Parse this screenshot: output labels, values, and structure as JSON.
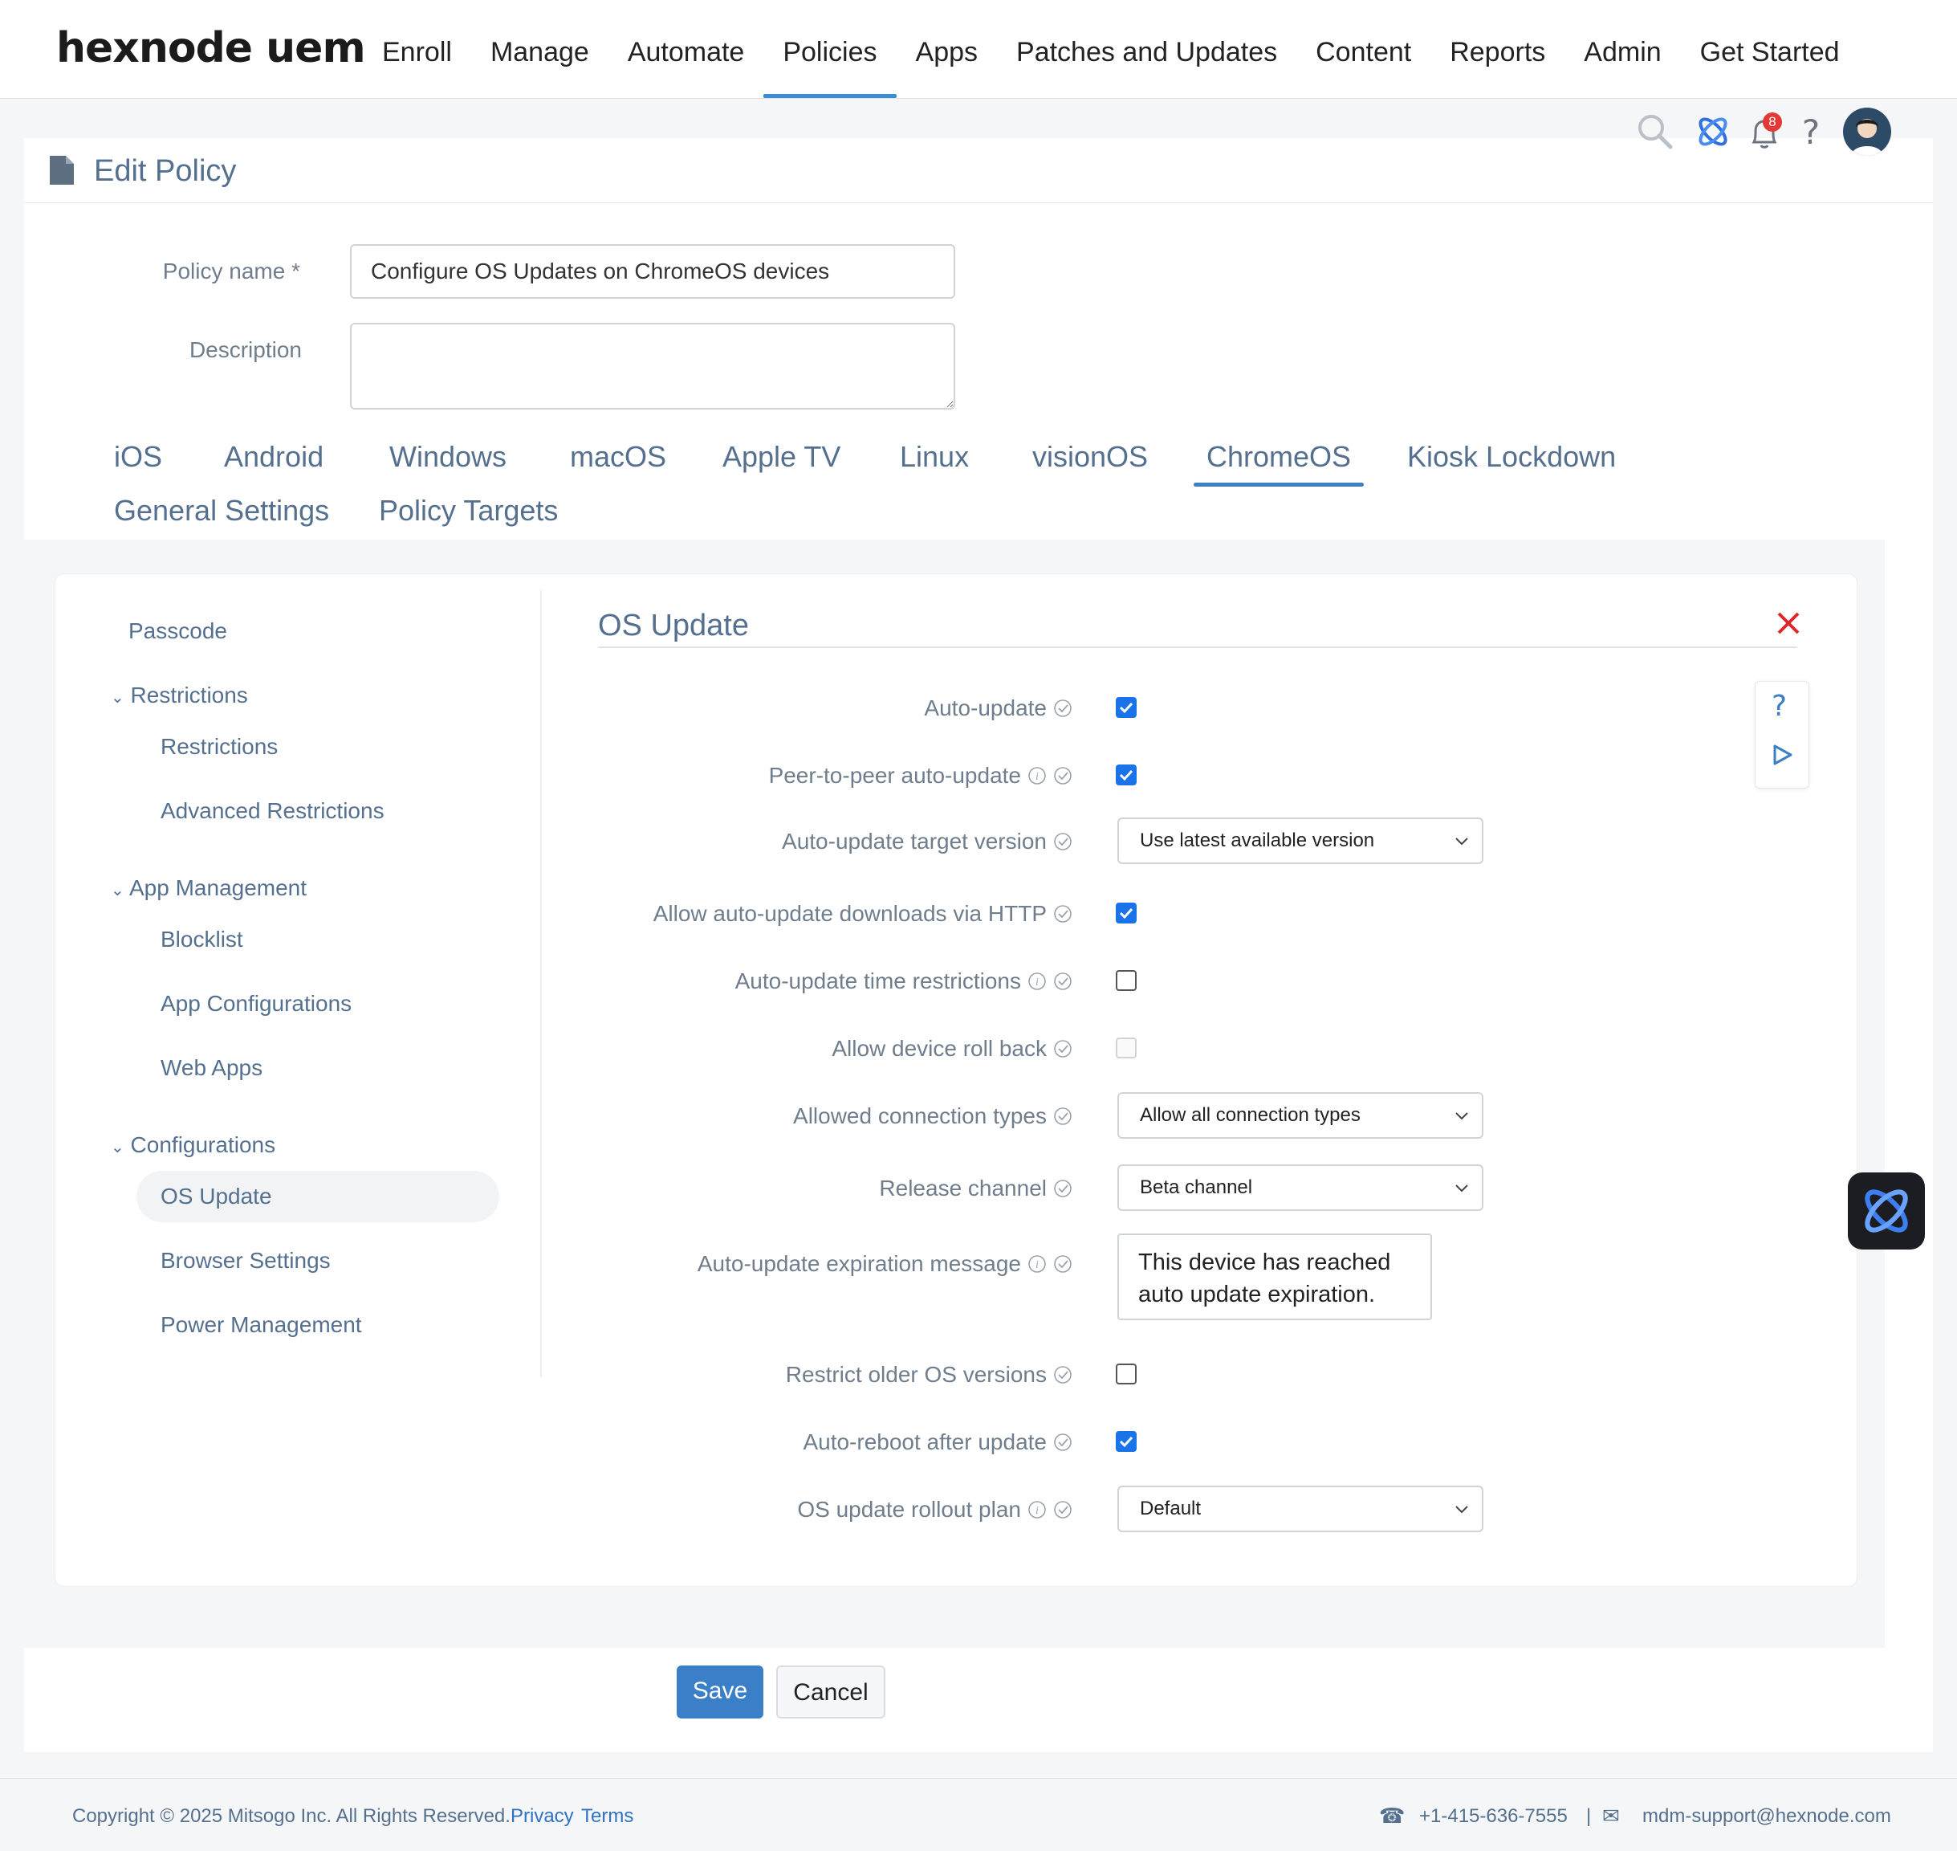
{
  "brand": {
    "logo_text": "hexnode uem"
  },
  "nav": {
    "items": [
      "Enroll",
      "Manage",
      "Automate",
      "Policies",
      "Apps",
      "Patches and Updates",
      "Content",
      "Reports",
      "Admin",
      "Get Started"
    ],
    "active": "Policies"
  },
  "header_icons": {
    "notification_count": "8"
  },
  "page": {
    "title": "Edit Policy"
  },
  "form": {
    "policy_name_label": "Policy name",
    "required_mark": "*",
    "policy_name_value": "Configure OS Updates on ChromeOS devices",
    "description_label": "Description",
    "description_value": ""
  },
  "os_tabs": {
    "row1": [
      "iOS",
      "Android",
      "Windows",
      "macOS",
      "Apple TV",
      "Linux",
      "visionOS",
      "ChromeOS",
      "Kiosk Lockdown"
    ],
    "row2": [
      "General Settings",
      "Policy Targets"
    ],
    "active": "ChromeOS"
  },
  "sidebar": {
    "passcode": "Passcode",
    "groups": [
      {
        "label": "Restrictions",
        "items": [
          "Restrictions",
          "Advanced Restrictions"
        ]
      },
      {
        "label": "App Management",
        "items": [
          "Blocklist",
          "App Configurations",
          "Web Apps"
        ]
      },
      {
        "label": "Configurations",
        "items": [
          "OS Update",
          "Browser Settings",
          "Power Management"
        ]
      }
    ],
    "active": "OS Update"
  },
  "section": {
    "title": "OS Update",
    "settings": [
      {
        "label": "Auto-update",
        "type": "checkbox",
        "checked": true,
        "info": false
      },
      {
        "label": "Peer-to-peer auto-update",
        "type": "checkbox",
        "checked": true,
        "info": true
      },
      {
        "label": "Auto-update target version",
        "type": "select",
        "value": "Use latest available version",
        "info": false
      },
      {
        "label": "Allow auto-update downloads via HTTP",
        "type": "checkbox",
        "checked": true,
        "info": false
      },
      {
        "label": "Auto-update time restrictions",
        "type": "checkbox",
        "checked": false,
        "info": true
      },
      {
        "label": "Allow device roll back",
        "type": "checkbox",
        "checked": false,
        "disabled": true,
        "info": false
      },
      {
        "label": "Allowed connection types",
        "type": "select",
        "value": "Allow all connection types",
        "info": false
      },
      {
        "label": "Release channel",
        "type": "select",
        "value": "Beta channel",
        "info": false
      },
      {
        "label": "Auto-update expiration message",
        "type": "textarea",
        "value": "This device has reached auto update expiration.",
        "info": true
      },
      {
        "label": "Restrict older OS versions",
        "type": "checkbox",
        "checked": false,
        "info": false
      },
      {
        "label": "Auto-reboot after update",
        "type": "checkbox",
        "checked": true,
        "info": false
      },
      {
        "label": "OS update rollout plan",
        "type": "select",
        "value": "Default",
        "info": true
      }
    ]
  },
  "buttons": {
    "save": "Save",
    "cancel": "Cancel"
  },
  "footer": {
    "copyright": "Copyright © 2025 Mitsogo Inc. All Rights Reserved.",
    "privacy": "Privacy",
    "terms": "Terms",
    "phone": "+1-415-636-7555",
    "separator": "|",
    "email": "mdm-support@hexnode.com"
  },
  "colors": {
    "accent": "#3a8cd6",
    "save_button": "#3a7fc8",
    "checkbox": "#1a73e8",
    "close_x": "#e0262b",
    "notification_badge": "#e53935",
    "label": "#55708f"
  }
}
